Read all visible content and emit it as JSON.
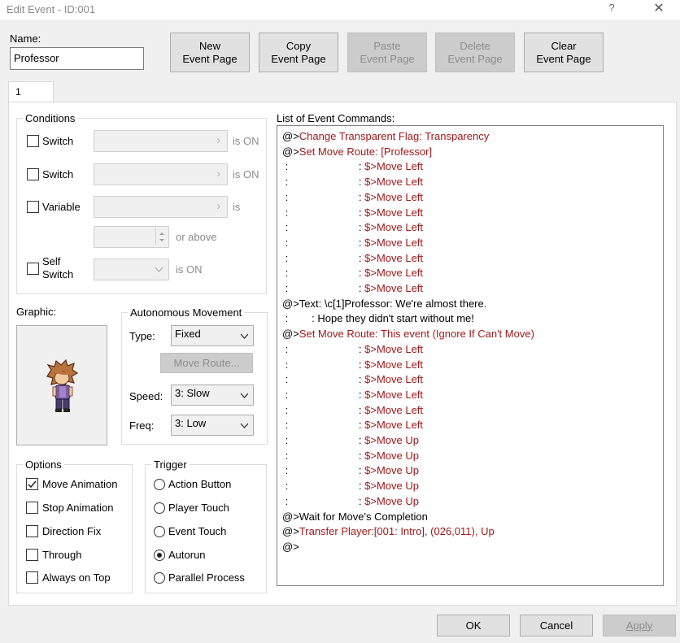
{
  "window": {
    "title": "Edit Event - ID:001",
    "help": "?",
    "close": "✕"
  },
  "name": {
    "label": "Name:",
    "value": "Professor"
  },
  "page_buttons": [
    {
      "line1": "New",
      "line2": "Event Page",
      "enabled": true
    },
    {
      "line1": "Copy",
      "line2": "Event Page",
      "enabled": true
    },
    {
      "line1": "Paste",
      "line2": "Event Page",
      "enabled": false
    },
    {
      "line1": "Delete",
      "line2": "Event Page",
      "enabled": false
    },
    {
      "line1": "Clear",
      "line2": "Event Page",
      "enabled": true
    }
  ],
  "tab": {
    "label": "1"
  },
  "conditions": {
    "title": "Conditions",
    "switch1": {
      "label": "Switch",
      "suffix": "is ON",
      "checked": false
    },
    "switch2": {
      "label": "Switch",
      "suffix": "is ON",
      "checked": false
    },
    "variable": {
      "label": "Variable",
      "suffix": "is",
      "checked": false
    },
    "above": {
      "suffix": "or above"
    },
    "self_switch": {
      "label_line1": "Self",
      "label_line2": "Switch",
      "suffix": "is ON",
      "checked": false
    }
  },
  "graphic": {
    "label": "Graphic:"
  },
  "autonomous": {
    "title": "Autonomous Movement",
    "type_label": "Type:",
    "type_value": "Fixed",
    "move_route_button": "Move Route...",
    "speed_label": "Speed:",
    "speed_value": "3: Slow",
    "freq_label": "Freq:",
    "freq_value": "3: Low"
  },
  "options": {
    "title": "Options",
    "items": [
      {
        "label": "Move Animation",
        "checked": true
      },
      {
        "label": "Stop Animation",
        "checked": false
      },
      {
        "label": "Direction Fix",
        "checked": false
      },
      {
        "label": "Through",
        "checked": false
      },
      {
        "label": "Always on Top",
        "checked": false
      }
    ]
  },
  "trigger": {
    "title": "Trigger",
    "items": [
      {
        "label": "Action Button",
        "selected": false
      },
      {
        "label": "Player Touch",
        "selected": false
      },
      {
        "label": "Event Touch",
        "selected": false
      },
      {
        "label": "Autorun",
        "selected": true
      },
      {
        "label": "Parallel Process",
        "selected": false
      }
    ]
  },
  "commands": {
    "label": "List of Event Commands:",
    "lines": [
      {
        "prefix": "@>",
        "text": "Change Transparent Flag: Transparency",
        "color": "red"
      },
      {
        "prefix": "@>",
        "text": "Set Move Route: [Professor]",
        "color": "red"
      },
      {
        "prefix": " :                        : ",
        "text": "$>Move Left",
        "color": "red"
      },
      {
        "prefix": " :                        : ",
        "text": "$>Move Left",
        "color": "red"
      },
      {
        "prefix": " :                        : ",
        "text": "$>Move Left",
        "color": "red"
      },
      {
        "prefix": " :                        : ",
        "text": "$>Move Left",
        "color": "red"
      },
      {
        "prefix": " :                        : ",
        "text": "$>Move Left",
        "color": "red"
      },
      {
        "prefix": " :                        : ",
        "text": "$>Move Left",
        "color": "red"
      },
      {
        "prefix": " :                        : ",
        "text": "$>Move Left",
        "color": "red"
      },
      {
        "prefix": " :                        : ",
        "text": "$>Move Left",
        "color": "red"
      },
      {
        "prefix": " :                        : ",
        "text": "$>Move Left",
        "color": "red"
      },
      {
        "prefix": "@>",
        "text": "Text: \\c[1]Professor: We're almost there.",
        "color": "black"
      },
      {
        "prefix": " :        ",
        "text": ": Hope they didn't start without me!",
        "color": "black"
      },
      {
        "prefix": "@>",
        "text": "Set Move Route: This event (Ignore If Can't Move)",
        "color": "red"
      },
      {
        "prefix": " :                        : ",
        "text": "$>Move Left",
        "color": "red"
      },
      {
        "prefix": " :                        : ",
        "text": "$>Move Left",
        "color": "red"
      },
      {
        "prefix": " :                        : ",
        "text": "$>Move Left",
        "color": "red"
      },
      {
        "prefix": " :                        : ",
        "text": "$>Move Left",
        "color": "red"
      },
      {
        "prefix": " :                        : ",
        "text": "$>Move Left",
        "color": "red"
      },
      {
        "prefix": " :                        : ",
        "text": "$>Move Left",
        "color": "red"
      },
      {
        "prefix": " :                        : ",
        "text": "$>Move Up",
        "color": "red"
      },
      {
        "prefix": " :                        : ",
        "text": "$>Move Up",
        "color": "red"
      },
      {
        "prefix": " :                        : ",
        "text": "$>Move Up",
        "color": "red"
      },
      {
        "prefix": " :                        : ",
        "text": "$>Move Up",
        "color": "red"
      },
      {
        "prefix": " :                        : ",
        "text": "$>Move Up",
        "color": "red"
      },
      {
        "prefix": "@>",
        "text": "Wait for Move's Completion",
        "color": "black"
      },
      {
        "prefix": "@>",
        "text": "Transfer Player:[001: Intro], (026,011), Up",
        "color": "red"
      },
      {
        "prefix": "@>",
        "text": "",
        "color": "black"
      }
    ]
  },
  "footer": {
    "ok": "OK",
    "cancel": "Cancel",
    "apply": "Apply"
  },
  "colors": {
    "command_red": "#a01818",
    "disabled_text": "#8c8c8c"
  }
}
